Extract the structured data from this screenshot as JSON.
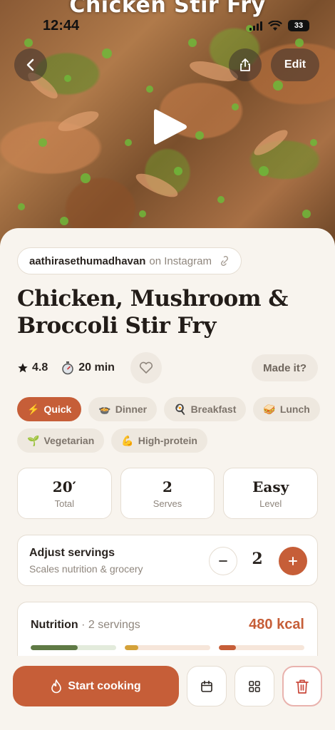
{
  "status_bar": {
    "time": "12:44",
    "battery": "33"
  },
  "hero": {
    "overlay_title": "Chicken Stir Fry",
    "edit_label": "Edit",
    "icons": {
      "back": "chevron-left-icon",
      "share": "share-icon",
      "play": "play-icon"
    }
  },
  "source": {
    "handle": "aathirasethumadhavan",
    "platform": "on Instagram",
    "icon": "link-icon"
  },
  "recipe": {
    "title": "Chicken, Mushroom & Broccoli Stir Fry"
  },
  "meta": {
    "rating": "4.8",
    "time": "20 min",
    "made_it_label": "Made it?"
  },
  "tags": [
    {
      "emoji": "⚡",
      "label": "Quick",
      "active": true
    },
    {
      "emoji": "🍲",
      "label": "Dinner",
      "active": false
    },
    {
      "emoji": "🍳",
      "label": "Breakfast",
      "active": false
    },
    {
      "emoji": "🥪",
      "label": "Lunch",
      "active": false
    },
    {
      "emoji": "🌱",
      "label": "Vegetarian",
      "active": false
    },
    {
      "emoji": "💪",
      "label": "High-protein",
      "active": false
    }
  ],
  "stats": [
    {
      "value": "20′",
      "label": "Total"
    },
    {
      "value": "2",
      "label": "Serves"
    },
    {
      "value": "Easy",
      "label": "Level"
    }
  ],
  "servings": {
    "title": "Adjust servings",
    "subtitle": "Scales nutrition & grocery",
    "count": "2"
  },
  "nutrition": {
    "title": "Nutrition",
    "subtitle": "· 2 servings",
    "kcal": "480 kcal",
    "bars": [
      {
        "fill": 0.55,
        "color": "#5f7a45",
        "track": "#e3ebdc"
      },
      {
        "fill": 0.16,
        "color": "#d4a23a",
        "track": "#f6e6da"
      },
      {
        "fill": 0.2,
        "color": "#c65e38",
        "track": "#f6e6da"
      }
    ]
  },
  "bottom": {
    "start_label": "Start cooking"
  },
  "colors": {
    "accent": "#c65e38",
    "background": "#f8f4ee"
  }
}
